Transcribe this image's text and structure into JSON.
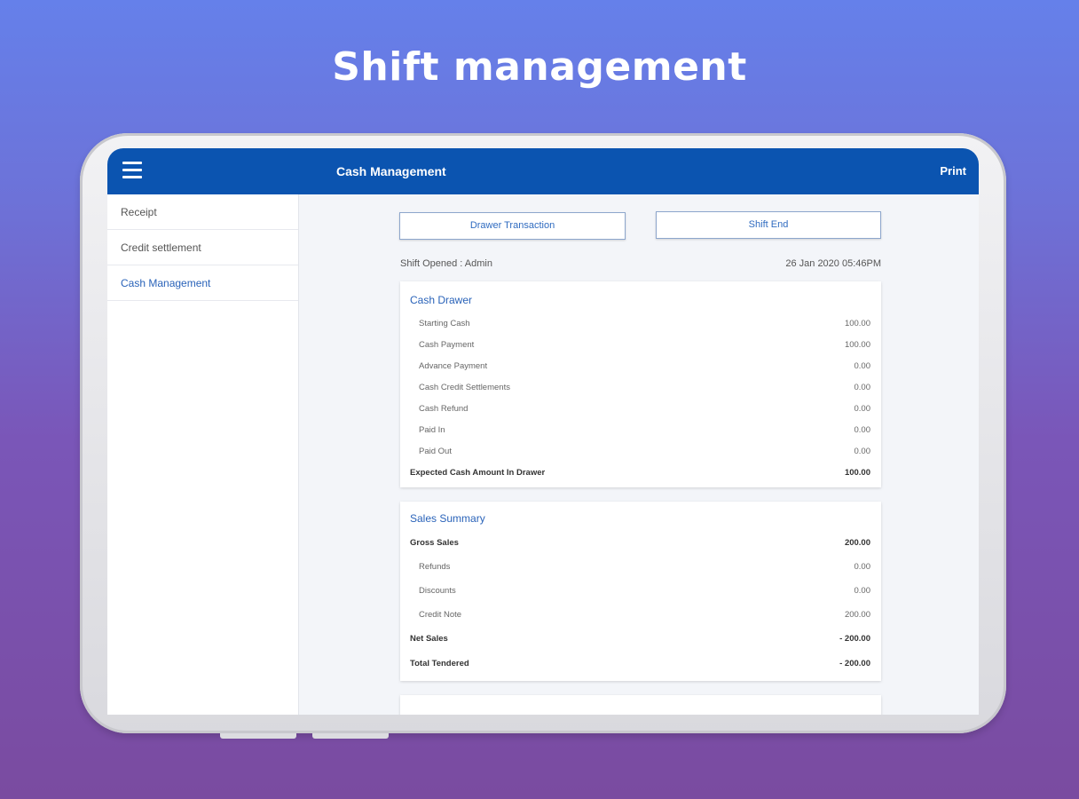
{
  "headline": "Shift management",
  "appbar": {
    "title": "Cash Management",
    "print_label": "Print"
  },
  "sidebar": {
    "items": [
      {
        "label": "Receipt"
      },
      {
        "label": "Credit settlement"
      },
      {
        "label": "Cash Management"
      }
    ]
  },
  "actions": {
    "drawer_transaction": "Drawer Transaction",
    "shift_end": "Shift End"
  },
  "shift": {
    "opened": "Shift Opened : Admin",
    "datetime": "26 Jan 2020 05:46PM"
  },
  "cash_drawer": {
    "title": "Cash Drawer",
    "rows": [
      {
        "label": "Starting Cash",
        "value": "100.00"
      },
      {
        "label": "Cash Payment",
        "value": "100.00"
      },
      {
        "label": "Advance Payment",
        "value": "0.00"
      },
      {
        "label": "Cash Credit Settlements",
        "value": "0.00"
      },
      {
        "label": "Cash Refund",
        "value": "0.00"
      },
      {
        "label": "Paid In",
        "value": "0.00"
      },
      {
        "label": "Paid Out",
        "value": "0.00"
      }
    ],
    "total": {
      "label": "Expected Cash Amount In Drawer",
      "value": "100.00"
    }
  },
  "sales_summary": {
    "title": "Sales Summary",
    "gross": {
      "label": "Gross Sales",
      "value": "200.00"
    },
    "rows": [
      {
        "label": "Refunds",
        "value": "0.00"
      },
      {
        "label": "Discounts",
        "value": "0.00"
      },
      {
        "label": "Credit Note",
        "value": "200.00"
      }
    ],
    "net": {
      "label": "Net Sales",
      "value": "- 200.00"
    },
    "tendered": {
      "label": "Total Tendered",
      "value": "- 200.00"
    }
  },
  "colors": {
    "appbar": "#0b54b0",
    "accent": "#2a63b9",
    "background_top": "#6580ea",
    "background_bottom": "#7a4ba0"
  }
}
